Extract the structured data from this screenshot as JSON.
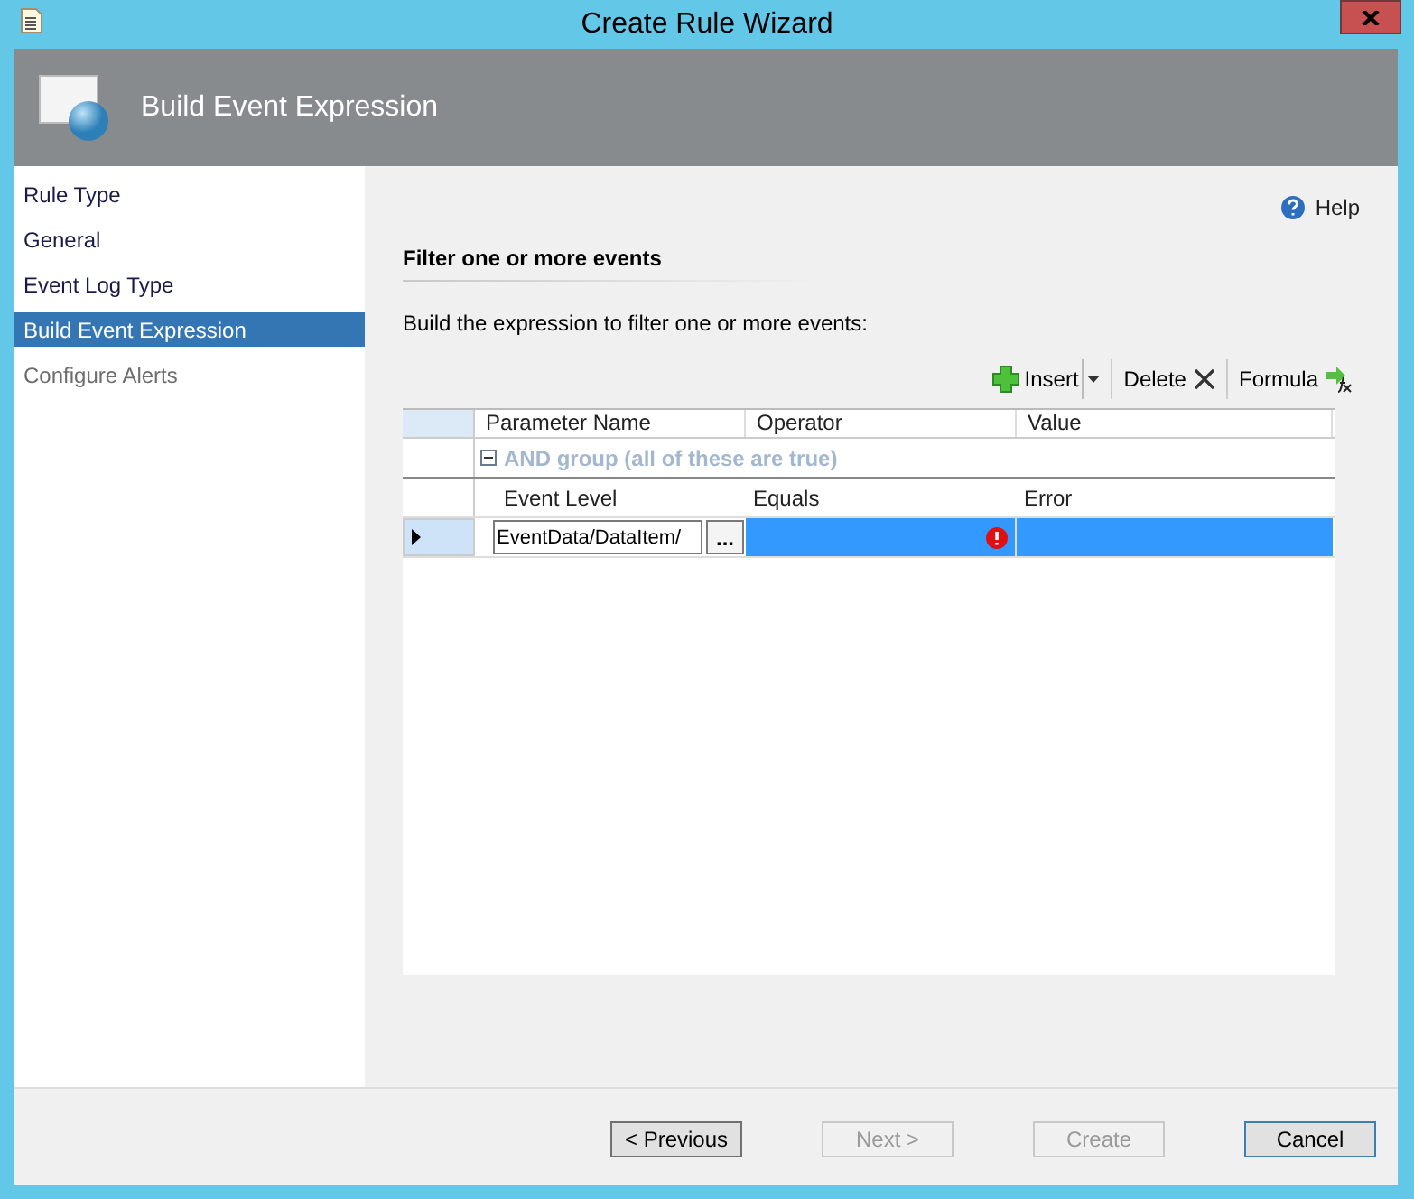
{
  "window": {
    "title": "Create Rule Wizard"
  },
  "header": {
    "title": "Build Event Expression"
  },
  "sidebar": {
    "items": [
      {
        "label": "Rule Type",
        "selected": false,
        "disabled": false
      },
      {
        "label": "General",
        "selected": false,
        "disabled": false
      },
      {
        "label": "Event Log Type",
        "selected": false,
        "disabled": false
      },
      {
        "label": "Build Event Expression",
        "selected": true,
        "disabled": false
      },
      {
        "label": "Configure Alerts",
        "selected": false,
        "disabled": true
      }
    ]
  },
  "help": "Help",
  "section_title": "Filter one or more events",
  "instruction": "Build the expression to filter one or more events:",
  "toolbar": {
    "insert": "Insert",
    "delete": "Delete",
    "formula": "Formula"
  },
  "grid": {
    "columns": [
      "Parameter Name",
      "Operator",
      "Value"
    ],
    "group": {
      "label": "AND group (all of these are true)",
      "expanded": true
    },
    "rows": [
      {
        "kind": "plain",
        "selected": false,
        "parameter": "Event Level",
        "operator": "Equals",
        "value": "Error"
      },
      {
        "kind": "editing",
        "selected": true,
        "parameter": "EventData/DataItem/",
        "browse": "...",
        "operator": "",
        "value": "",
        "error": true
      }
    ]
  },
  "buttons": [
    {
      "label": "< Previous",
      "disabled": false,
      "default": false
    },
    {
      "label": "Next >",
      "disabled": true,
      "default": false
    },
    {
      "label": "Create",
      "disabled": true,
      "default": false
    },
    {
      "label": "Cancel",
      "disabled": false,
      "default": true
    }
  ]
}
